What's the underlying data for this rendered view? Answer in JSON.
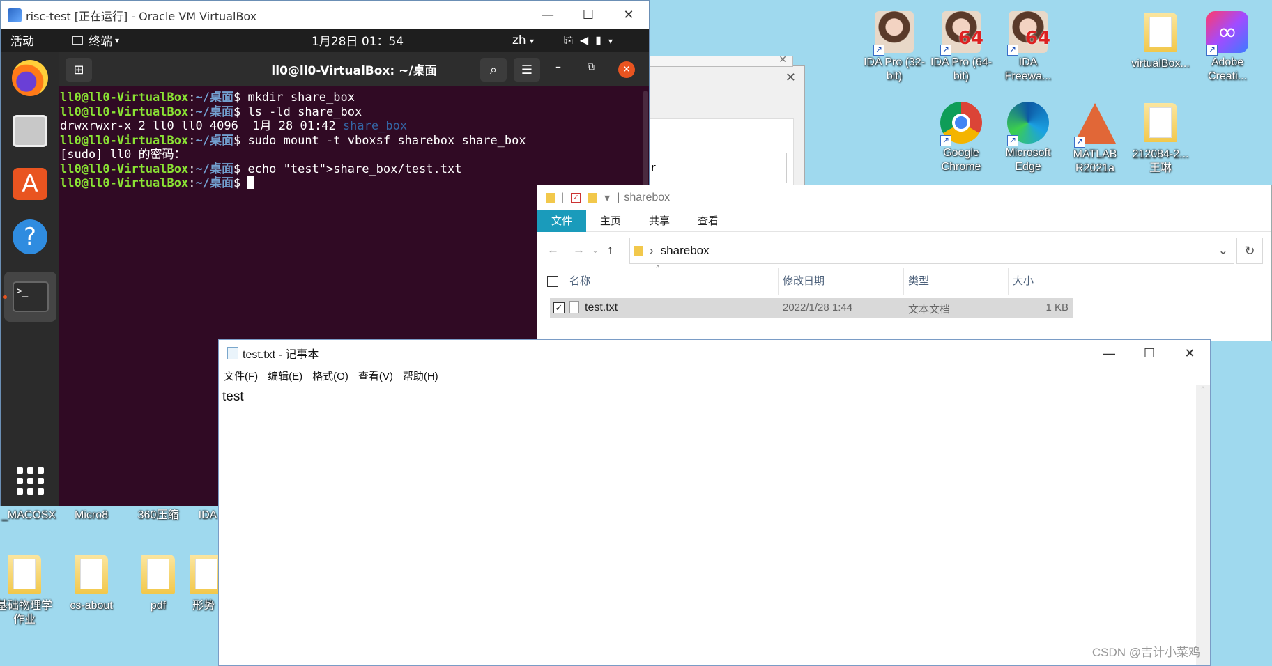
{
  "vbox": {
    "title": "risc-test [正在运行] - Oracle VM VirtualBox",
    "min": "—",
    "max": "☐",
    "close": "✕"
  },
  "gnome": {
    "activities": "活动",
    "app_menu": "终端",
    "clock": "1月28日  01：54",
    "lang": "zh"
  },
  "terminal": {
    "title": "ll0@ll0-VirtualBox: ~/桌面",
    "lines": [
      {
        "user": "ll0@ll0-VirtualBox",
        "path": "~/桌面",
        "cmd": "mkdir share_box"
      },
      {
        "user": "ll0@ll0-VirtualBox",
        "path": "~/桌面",
        "cmd": "ls -ld share_box"
      },
      {
        "text": "drwxrwxr-x 2 ll0 ll0 4096  1月 28 01:42 ",
        "dir": "share_box"
      },
      {
        "user": "ll0@ll0-VirtualBox",
        "path": "~/桌面",
        "cmd": "sudo mount -t vboxsf sharebox share_box"
      },
      {
        "text": "[sudo] ll0 的密码："
      },
      {
        "user": "ll0@ll0-VirtualBox",
        "path": "~/桌面",
        "cmd": "echo \"test\">share_box/test.txt"
      },
      {
        "user": "ll0@ll0-VirtualBox",
        "path": "~/桌面",
        "cmd": ""
      }
    ]
  },
  "desktop_icons": {
    "ida32": "IDA Pro (32-bit)",
    "ida64": "IDA Pro (64-bit)",
    "idafree": "IDA Freewa...",
    "virtualbox": "virtualBox...",
    "adobe": "Adobe Creati...",
    "chrome": "Google Chrome",
    "edge": "Microsoft Edge",
    "matlab": "MATLAB R2021a",
    "folder212": "212084-2... 王琳",
    "macosx": "_MACOSX",
    "micro8": "Micro8",
    "zip360": "360压缩",
    "ida": "IDA",
    "physics": "基础物理学作业",
    "csabout": "cs-about",
    "pdf": "pdf",
    "xingshi": "形势"
  },
  "explorer": {
    "path_title": "sharebox",
    "tabs": [
      "文件",
      "主页",
      "共享",
      "查看"
    ],
    "address": "sharebox",
    "columns": {
      "name": "名称",
      "modified": "修改日期",
      "type": "类型",
      "size": "大小"
    },
    "files": [
      {
        "name": "test.txt",
        "modified": "2022/1/28 1:44",
        "type": "文本文档",
        "size": "1 KB"
      }
    ]
  },
  "notepad": {
    "title": "test.txt - 记事本",
    "menu": [
      "文件(F)",
      "编辑(E)",
      "格式(O)",
      "查看(V)",
      "帮助(H)"
    ],
    "content": "test"
  },
  "watermark": "CSDN @吉计小菜鸡"
}
